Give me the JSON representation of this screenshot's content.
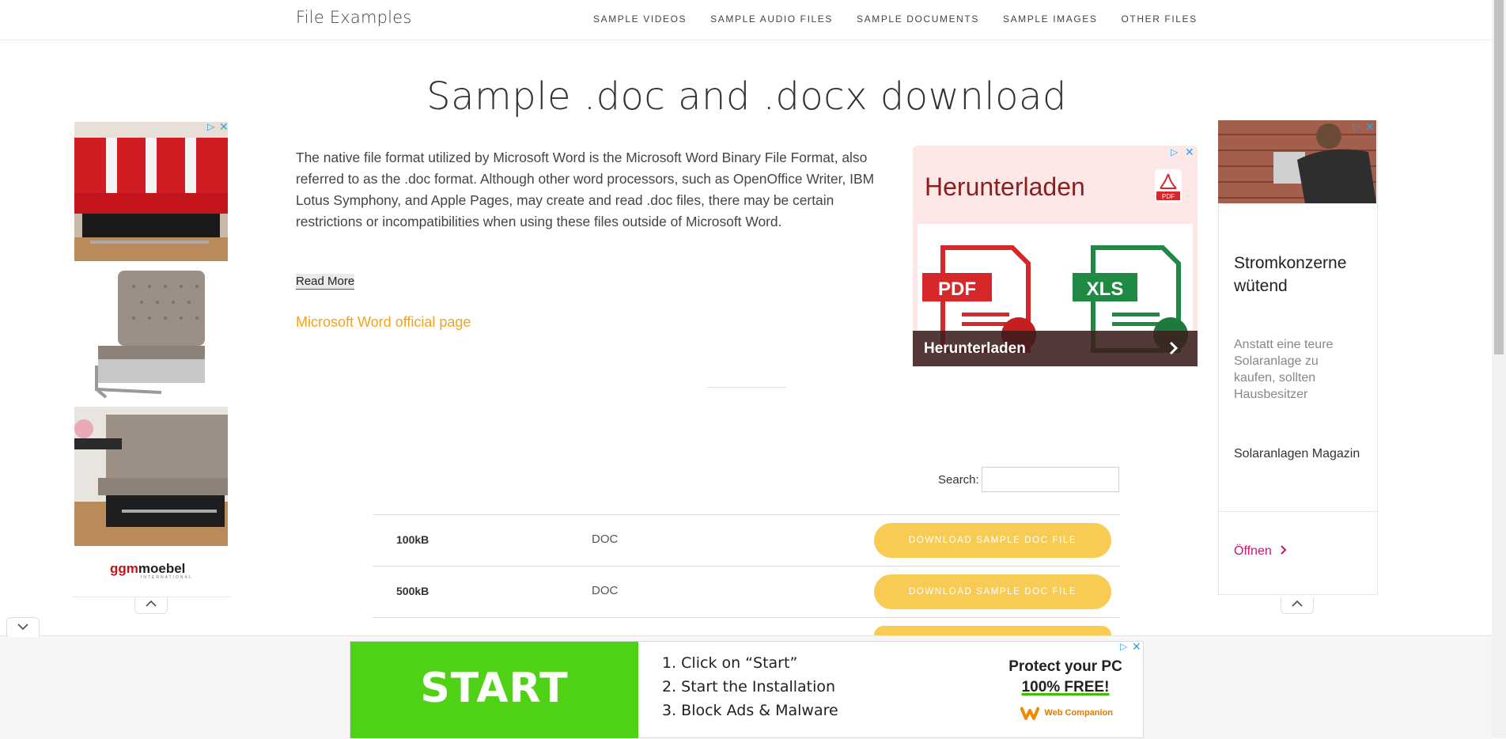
{
  "header": {
    "site_title": "File Examples",
    "nav": [
      "SAMPLE VIDEOS",
      "SAMPLE AUDIO FILES",
      "SAMPLE DOCUMENTS",
      "SAMPLE IMAGES",
      "OTHER FILES"
    ]
  },
  "main": {
    "title": "Sample .doc and .docx download",
    "intro": "The native file format utilized by Microsoft Word is the Microsoft Word Binary File Format, also referred to as the .doc format. Although other word processors, such as OpenOffice Writer, IBM Lotus Symphony, and Apple Pages, may create and read .doc files, there may be certain restrictions or incompatibilities when using these files outside of Microsoft Word.",
    "read_more": "Read More",
    "official_link": "Microsoft Word official page"
  },
  "table": {
    "search_label": "Search:",
    "search_value": "",
    "rows": [
      {
        "size": "100kB",
        "type": "DOC",
        "button": "DOWNLOAD SAMPLE DOC FILE"
      },
      {
        "size": "500kB",
        "type": "DOC",
        "button": "DOWNLOAD SAMPLE DOC FILE"
      }
    ]
  },
  "ads": {
    "middle": {
      "headline": "Herunterladen",
      "pdf_badge": "PDF",
      "doc1_label": "PDF",
      "doc2_label": "XLS",
      "bar_label": "Herunterladen"
    },
    "left": {
      "brand_red": "ggm",
      "brand_dark": "moebel",
      "brand_sub": "INTERNATIONAL"
    },
    "right": {
      "headline": "Stromkonzerne wütend",
      "body": "Anstatt eine teure Solaranlage zu kaufen, sollten Hausbesitzer",
      "source": "Solaranlagen Magazin",
      "cta": "Öffnen"
    },
    "bottom": {
      "start": "START",
      "steps": [
        "1. Click on “Start”",
        "2. Start the Installation",
        "3. Block Ads & Malware"
      ],
      "promo_line1": "Protect your PC",
      "promo_line2": "100% FREE!",
      "brand": "Web Companion"
    }
  },
  "colors": {
    "accent_link": "#f0a41f",
    "download_button": "#f8cb55",
    "ad_green": "#4fd116",
    "cta_magenta": "#c21a6b"
  },
  "icons": {
    "adchoices": "adchoices-icon",
    "close": "close-icon",
    "chevron_up": "chevron-up-icon",
    "chevron_down": "chevron-down-icon",
    "chevron_right": "chevron-right-icon"
  }
}
